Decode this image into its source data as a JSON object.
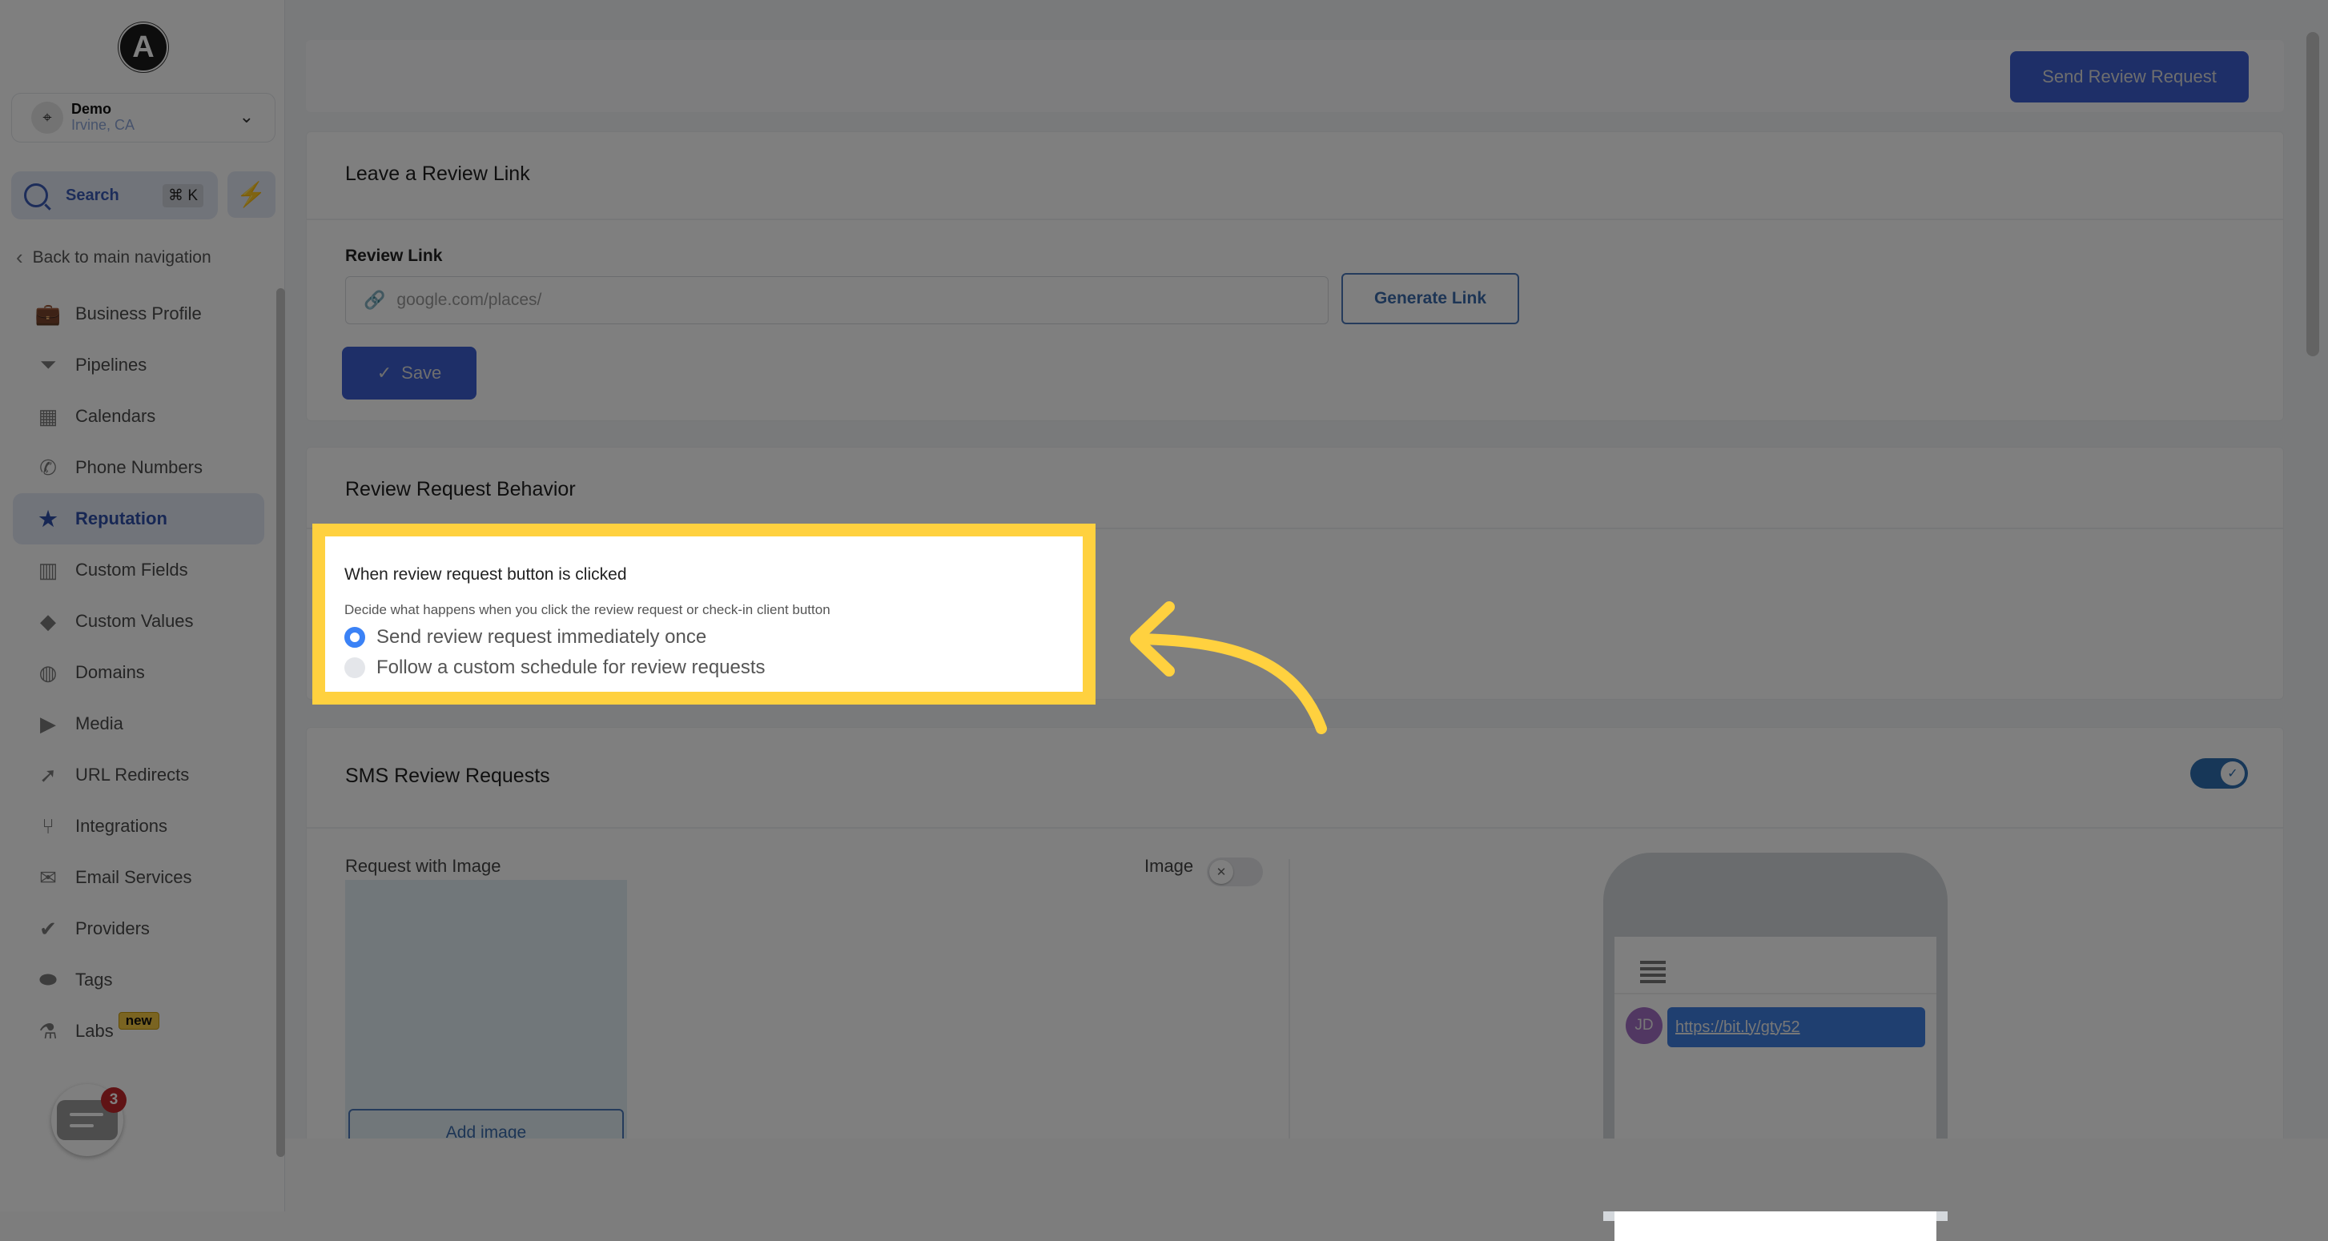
{
  "sidebar": {
    "logo_letter": "A",
    "location": {
      "name": "Demo",
      "city": "Irvine, CA"
    },
    "search": {
      "label": "Search",
      "shortcut": "⌘ K"
    },
    "back_label": "Back to main navigation",
    "items": [
      {
        "label": "Business Profile",
        "icon": "briefcase-icon",
        "glyph": "💼",
        "active": false
      },
      {
        "label": "Pipelines",
        "icon": "funnel-icon",
        "glyph": "⏷",
        "active": false
      },
      {
        "label": "Calendars",
        "icon": "calendar-icon",
        "glyph": "▦",
        "active": false
      },
      {
        "label": "Phone Numbers",
        "icon": "phone-icon",
        "glyph": "✆",
        "active": false
      },
      {
        "label": "Reputation",
        "icon": "star-icon",
        "glyph": "★",
        "active": true
      },
      {
        "label": "Custom Fields",
        "icon": "field-icon",
        "glyph": "▥",
        "active": false
      },
      {
        "label": "Custom Values",
        "icon": "gem-icon",
        "glyph": "◆",
        "active": false
      },
      {
        "label": "Domains",
        "icon": "globe-icon",
        "glyph": "◍",
        "active": false
      },
      {
        "label": "Media",
        "icon": "video-icon",
        "glyph": "▶",
        "active": false
      },
      {
        "label": "URL Redirects",
        "icon": "redirect-icon",
        "glyph": "➚",
        "active": false
      },
      {
        "label": "Integrations",
        "icon": "integration-icon",
        "glyph": "⑂",
        "active": false
      },
      {
        "label": "Email Services",
        "icon": "mail-icon",
        "glyph": "✉",
        "active": false
      },
      {
        "label": "Providers",
        "icon": "clipboard-icon",
        "glyph": "✔",
        "active": false
      },
      {
        "label": "Tags",
        "icon": "tag-icon",
        "glyph": "⬬",
        "active": false
      },
      {
        "label": "Labs",
        "icon": "flask-icon",
        "glyph": "⚗",
        "active": false,
        "badge": "new"
      }
    ],
    "chat_badge_count": "3"
  },
  "header": {
    "send_button": "Send Review Request"
  },
  "review_link_card": {
    "title": "Leave a Review Link",
    "field_label": "Review Link",
    "input_placeholder": "google.com/places/",
    "generate_button": "Generate Link",
    "save_button": "Save"
  },
  "behavior_card": {
    "title": "Review Request Behavior",
    "question": "When review request button is clicked",
    "description": "Decide what happens when you click the review request or check-in client button",
    "options": [
      {
        "label": "Send review request immediately once",
        "selected": true
      },
      {
        "label": "Follow a custom schedule for review requests",
        "selected": false
      }
    ]
  },
  "sms_card": {
    "title": "SMS Review Requests",
    "enabled": true,
    "request_with_image_label": "Request with Image",
    "image_toggle_label": "Image",
    "image_enabled": false,
    "add_image_button": "Add image",
    "preview": {
      "avatar_initials": "JD",
      "message_link": "https://bit.ly/gty52"
    }
  },
  "colors": {
    "highlight": "#ffd13f",
    "primary": "#3c5fd1",
    "active_nav": "#2e4fa8"
  }
}
